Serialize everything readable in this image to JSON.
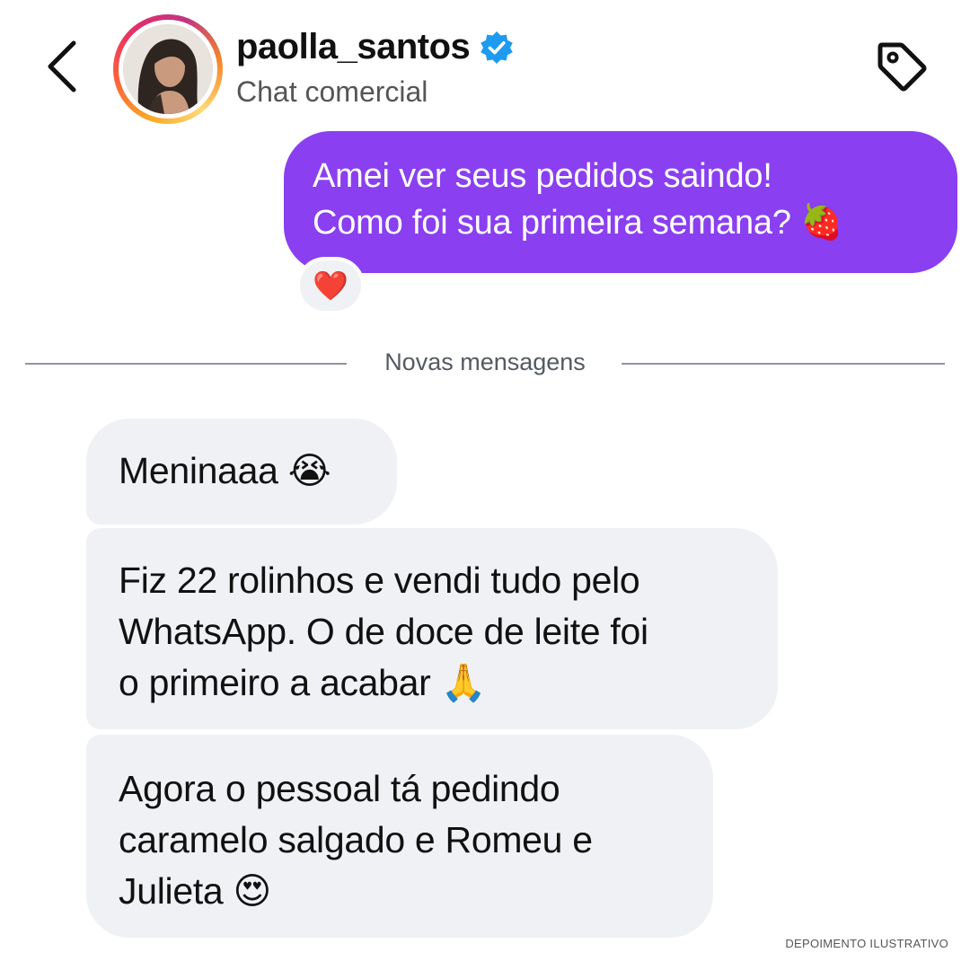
{
  "header": {
    "username": "paolla_santos",
    "subtitle": "Chat comercial",
    "verified_icon": "verified-badge-icon",
    "back_icon": "chevron-left-icon",
    "tag_icon": "tag-icon"
  },
  "messages": {
    "sent": {
      "lines": [
        "Amei ver seus pedidos saindo!",
        "Como foi sua primeira semana? 🍓"
      ],
      "reaction": "❤️"
    },
    "divider_label": "Novas mensagens",
    "received": [
      {
        "lines": [
          "Meninaaa 😭"
        ]
      },
      {
        "lines": [
          "Fiz 22 rolinhos e vendi tudo pelo",
          "WhatsApp. O de doce de leite foi",
          "o primeiro a acabar 🙏"
        ]
      },
      {
        "lines": [
          "Agora o pessoal tá pedindo",
          "caramelo salgado e Romeu e",
          "Julieta 😍"
        ]
      }
    ]
  },
  "footnote": "DEPOIMENTO ILUSTRATIVO",
  "colors": {
    "sent_bubble": "#8a3ff0",
    "received_bubble": "#f0f1f4",
    "verified": "#1d9bf0"
  }
}
